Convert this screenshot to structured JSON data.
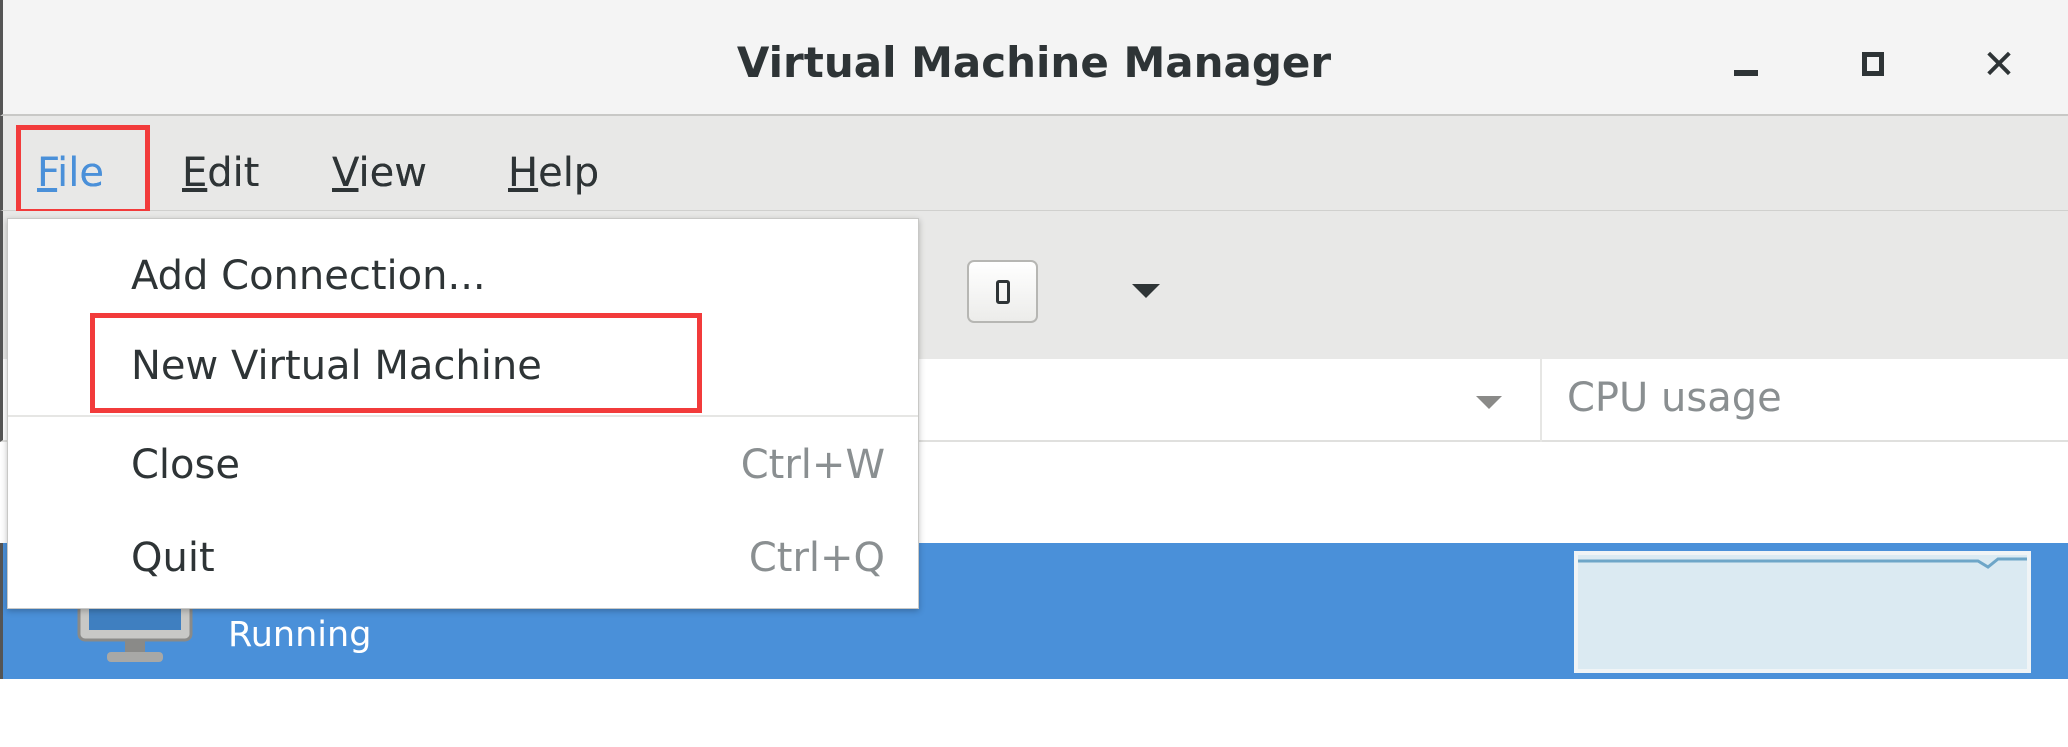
{
  "window": {
    "title": "Virtual Machine Manager",
    "minimize_icon": "minimize-icon",
    "maximize_icon": "maximize-icon",
    "close_icon": "close-icon"
  },
  "menubar": {
    "items": [
      {
        "label": "File",
        "mnemonic": "F",
        "rest": "ile"
      },
      {
        "label": "Edit",
        "mnemonic": "E",
        "rest": "dit"
      },
      {
        "label": "View",
        "mnemonic": "V",
        "rest": "iew"
      },
      {
        "label": "Help",
        "mnemonic": "H",
        "rest": "elp"
      }
    ]
  },
  "file_menu": {
    "items": [
      {
        "label": "Add Connection...",
        "shortcut": ""
      },
      {
        "label": "New Virtual Machine",
        "shortcut": ""
      },
      {
        "label": "Close",
        "shortcut": "Ctrl+W"
      },
      {
        "label": "Quit",
        "shortcut": "Ctrl+Q"
      }
    ]
  },
  "table": {
    "columns": [
      "",
      "CPU usage"
    ],
    "rows": [
      {
        "status": "Running",
        "selected": true
      }
    ]
  },
  "colors": {
    "accent": "#4a90d9",
    "highlight_box": "#f23b3b",
    "graph_fill": "#dbeaf2"
  }
}
